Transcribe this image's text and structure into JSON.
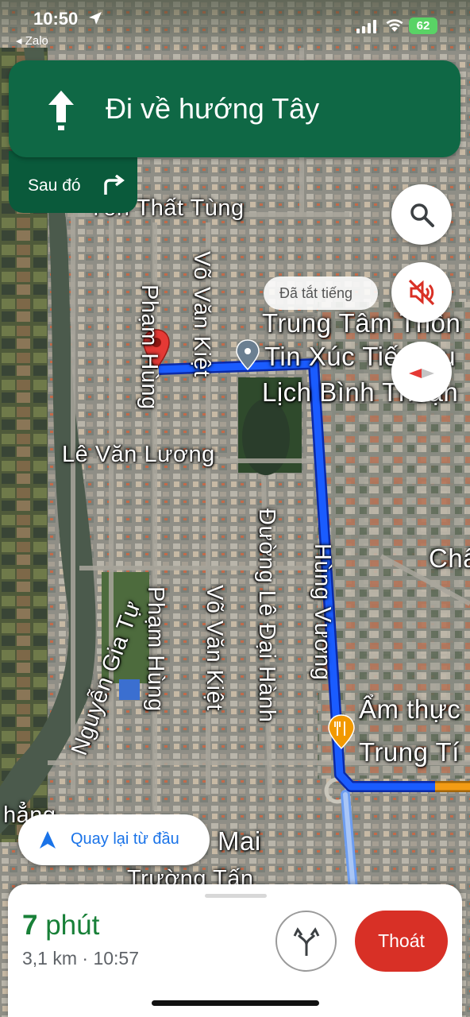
{
  "status_bar": {
    "time": "10:50",
    "back_app": "◂ Zalo",
    "battery": "62"
  },
  "navigation": {
    "instruction": "Đi về hướng Tây",
    "then_label": "Sau đó",
    "muted_toast": "Đã tắt tiếng"
  },
  "map_labels": {
    "ton_that_tung": "Tôn Thất Tùng",
    "vo_van_kiet_top": "Võ Văn Kiệt",
    "pham_hung_top": "Phạm Hùng",
    "le_van_luong": "Lê Văn Lương",
    "poi_line1": "Trung Tâm Thôn",
    "poi_line2": "Tin Xúc Tiến Du",
    "poi_line3": "Lịch Bình Thuận",
    "duong_le_dai_hanh": "Đường Lê Đại Hành",
    "hung_vuong": "Hùng Vương",
    "nguyen_gia_tu": "Nguyễn Gia Tự",
    "pham_hung_bottom": "Phạm Hùng",
    "vo_van_kiet_bottom": "Võ Văn Kiệt",
    "am_thuc_line1": "Ẩm thực",
    "am_thuc_line2": "Trung Tí",
    "cha": "Châ",
    "mai": "Mai",
    "thang": "hẳng",
    "truong_tan": "Trường Tấn"
  },
  "recenter": {
    "label": "Quay lại từ đầu"
  },
  "trip": {
    "duration_value": "7",
    "duration_unit": "phút",
    "details": "3,1 km · 10:57",
    "exit_label": "Thoát"
  },
  "icons": {
    "direction": "arrow-up-icon",
    "then": "turn-right-icon",
    "search": "search-icon",
    "mute": "volume-off-icon",
    "compass": "compass-icon",
    "recenter": "navigation-arrow-icon",
    "routes": "alt-routes-icon",
    "destination": "destination-pin-icon",
    "food": "restaurant-icon"
  },
  "colors": {
    "banner": "#0f6845",
    "route": "#1a5cff",
    "exit": "#d83026",
    "eta": "#188038",
    "recenter_text": "#1a73e8"
  }
}
